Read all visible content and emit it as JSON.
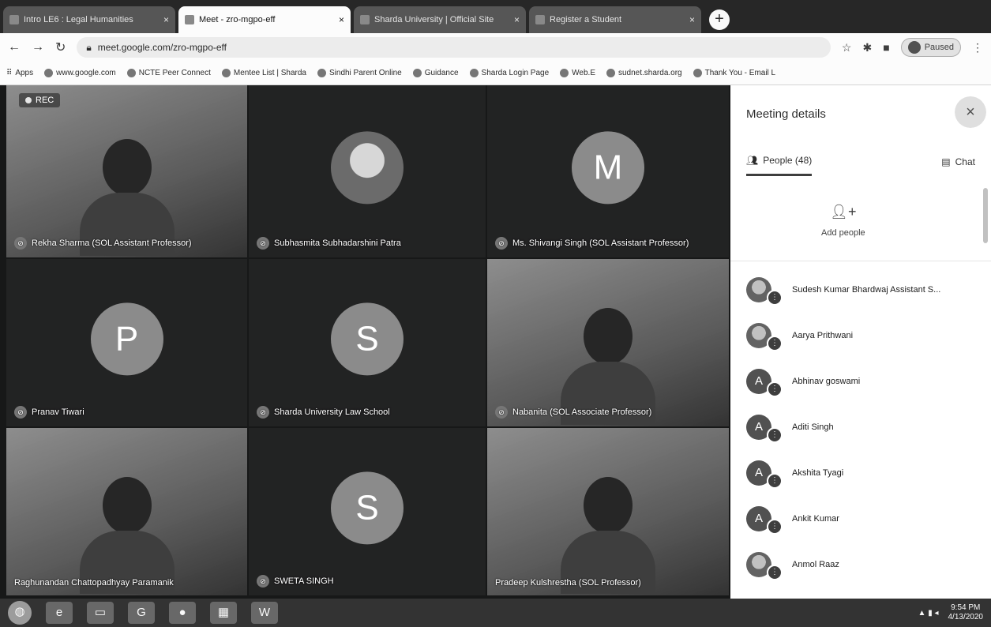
{
  "browser": {
    "tabs": [
      {
        "title": "Intro LE6 : Legal Humanities",
        "active": false
      },
      {
        "title": "Meet - zro-mgpo-eff",
        "active": true
      },
      {
        "title": "Sharda University | Official Site",
        "active": false
      },
      {
        "title": "Register a Student",
        "active": false
      }
    ],
    "new_tab_label": "+",
    "address": "meet.google.com/zro-mgpo-eff",
    "profile_label": "Paused",
    "bookmarks": [
      "Apps",
      "www.google.com",
      "NCTE Peer Connect",
      "Mentee List | Sharda",
      "Sindhi Parent Online",
      "Guidance",
      "Sharda Login Page",
      "Web.E",
      "sudnet.sharda.org",
      "Thank You - Email L"
    ]
  },
  "meet": {
    "recording_label": "REC",
    "tiles": [
      {
        "type": "video",
        "name": "Rekha Sharma (SOL Assistant Professor)",
        "rec": true
      },
      {
        "type": "photo-avatar",
        "name": "Subhasmita Subhadarshini Patra"
      },
      {
        "type": "letter",
        "letter": "M",
        "name": "Ms. Shivangi Singh (SOL Assistant Professor)"
      },
      {
        "type": "letter",
        "letter": "P",
        "name": "Pranav Tiwari"
      },
      {
        "type": "letter",
        "letter": "S",
        "name": "Sharda University Law School"
      },
      {
        "type": "video",
        "name": "Nabanita (SOL Associate Professor)"
      },
      {
        "type": "video",
        "name": "Raghunandan Chattopadhyay Paramanik"
      },
      {
        "type": "letter",
        "letter": "S",
        "name": "SWETA SINGH"
      },
      {
        "type": "video",
        "name": "Pradeep Kulshrestha (SOL Professor)"
      }
    ]
  },
  "panel": {
    "title": "Meeting details",
    "close_icon": "×",
    "people_tab": "People (48)",
    "chat_tab": "Chat",
    "add_people": "Add people",
    "people": [
      {
        "initial": "",
        "photo": true,
        "name": "Sudesh Kumar Bhardwaj Assistant S..."
      },
      {
        "initial": "",
        "photo": true,
        "name": "Aarya Prithwani"
      },
      {
        "initial": "A",
        "photo": false,
        "name": "Abhinav goswami"
      },
      {
        "initial": "A",
        "photo": false,
        "name": "Aditi Singh"
      },
      {
        "initial": "A",
        "photo": false,
        "name": "Akshita Tyagi"
      },
      {
        "initial": "A",
        "photo": false,
        "name": "Ankit Kumar"
      },
      {
        "initial": "",
        "photo": true,
        "name": "Anmol Raaz"
      }
    ]
  },
  "taskbar": {
    "apps": [
      "◍",
      "e",
      "▭",
      "G",
      "●",
      "▦",
      "W"
    ],
    "time": "9:54 PM",
    "date": "4/13/2020"
  }
}
